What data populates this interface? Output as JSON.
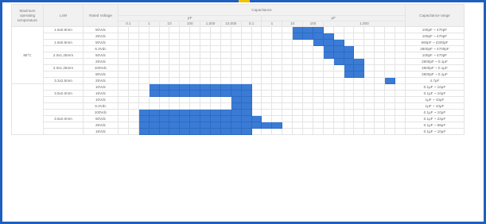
{
  "header": {
    "col_temperature": "Maximum operating temperature",
    "col_lxw": "LxW",
    "col_rated_voltage": "Rated Voltage",
    "col_capacitance": "Capacitance",
    "col_capacitance_range": "Capacitance range",
    "unit_left": "pF",
    "unit_right": "μF",
    "decades": [
      "0.1",
      "1",
      "10",
      "100",
      "1,000",
      "10,000",
      "0.1",
      "1",
      "10",
      "100",
      "1,000"
    ]
  },
  "groups": [
    {
      "temperature": "85°C",
      "rows": [
        {
          "lxw": "1.6x0.8mm",
          "voltage": "50Vdc",
          "range": "100pF ~ 470pF",
          "bar_from": 17,
          "bar_to": 19
        },
        {
          "lxw": "",
          "voltage": "25Vdc",
          "range": "100pF ~ 470pF",
          "bar_from": 17,
          "bar_to": 20
        },
        {
          "lxw": "1.6x0.8mm",
          "voltage": "50Vdc",
          "range": "560pF ~ 2200pF",
          "bar_from": 19,
          "bar_to": 21
        },
        {
          "lxw": "",
          "voltage": "6.3Vdc",
          "range": "2800pF ~ 4700pF",
          "bar_from": 20,
          "bar_to": 22
        },
        {
          "lxw": "2.0x1.25mm",
          "voltage": "50Vdc",
          "range": "100pF ~ 470pF",
          "bar_from": 20,
          "bar_to": 22
        },
        {
          "lxw": "",
          "voltage": "25Vdc",
          "range": "2800pF ~ 0.1μF",
          "bar_from": 21,
          "bar_to": 23
        },
        {
          "lxw": "2.0x1.25mm",
          "voltage": "100Vdc",
          "range": "2800pF ~ 0.1μF",
          "bar_from": 22,
          "bar_to": 23
        },
        {
          "lxw": "",
          "voltage": "50Vdc",
          "range": "2800pF ~ 0.1μF",
          "bar_from": 22,
          "bar_to": 23
        },
        {
          "lxw": "3.2x2.5mm",
          "voltage": "25Vdc",
          "range": "4.7μF",
          "bar_from": 26,
          "bar_to": 26
        }
      ]
    },
    {
      "temperature": "",
      "rows": [
        {
          "lxw": "",
          "voltage": "10Vdc",
          "range": "0.1μF ~ 10μF",
          "bar_from": 3,
          "bar_to": 12
        },
        {
          "lxw": "3.6x2.0mm",
          "voltage": "16Vdc",
          "range": "0.1μF ~ 10μF",
          "bar_from": 3,
          "bar_to": 12
        },
        {
          "lxw": "",
          "voltage": "10Vdc",
          "range": "1μF ~ 10μF",
          "bar_from": 11,
          "bar_to": 12
        },
        {
          "lxw": "",
          "voltage": "6.3Vdc",
          "range": "1μF ~ 10μF",
          "bar_from": 11,
          "bar_to": 12
        },
        {
          "lxw": "",
          "voltage": "100Vdc",
          "range": "0.1μF ~ 10μF",
          "bar_from": 2,
          "bar_to": 12
        },
        {
          "lxw": "3.6x2.0mm",
          "voltage": "50Vdc",
          "range": "0.1μF ~ 22μF",
          "bar_from": 2,
          "bar_to": 13
        },
        {
          "lxw": "",
          "voltage": "25Vdc",
          "range": "0.1μF ~ 68μF",
          "bar_from": 2,
          "bar_to": 15
        },
        {
          "lxw": "",
          "voltage": "16Vdc",
          "range": "0.1μF ~ 10μF",
          "bar_from": 2,
          "bar_to": 12
        }
      ]
    }
  ]
}
